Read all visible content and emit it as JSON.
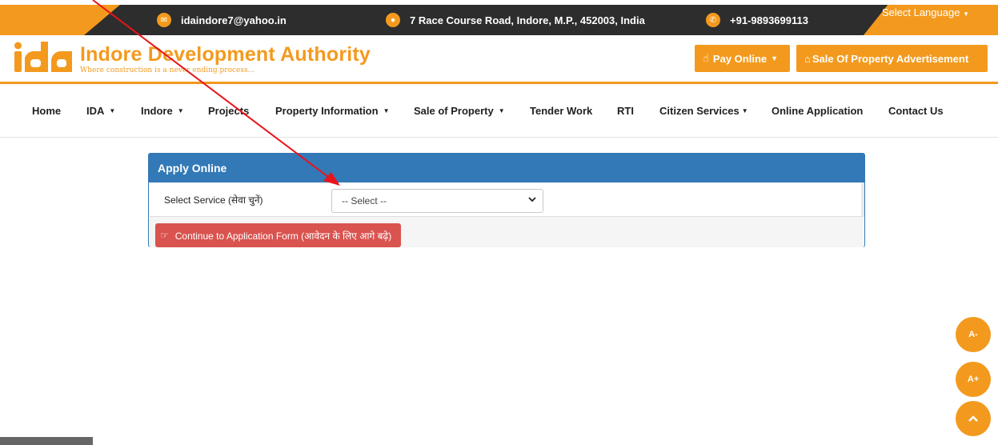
{
  "topbar": {
    "email": "idaindore7@yahoo.in",
    "address": "7 Race Course Road, Indore, M.P., 452003, India",
    "phone": "+91-9893699113",
    "language": "Select Language"
  },
  "header": {
    "logo_text": "ida",
    "title": "Indore Development Authority",
    "tagline": "Where construction is a never ending process...",
    "pay_online": "Pay Online",
    "sale_ad": "Sale Of Property Advertisement"
  },
  "nav": {
    "items": [
      {
        "label": "Home"
      },
      {
        "label": "IDA"
      },
      {
        "label": "Indore"
      },
      {
        "label": "Projects"
      },
      {
        "label": "Property Information"
      },
      {
        "label": "Sale of Property"
      },
      {
        "label": "Tender Work"
      },
      {
        "label": "RTI"
      },
      {
        "label": "Citizen Services"
      },
      {
        "label": "Online Application"
      },
      {
        "label": "Contact Us"
      }
    ]
  },
  "panel": {
    "heading": "Apply Online",
    "select_label": "Select Service  (सेवा चुनें)",
    "select_value": "-- Select --",
    "continue_label": "Continue to Application Form (आवेदन के लिए आगे बढ़े)"
  },
  "floating": {
    "decrease": "A-",
    "increase": "A+"
  },
  "colors": {
    "accent": "#f39a1e",
    "dark_bar": "#2d2d2d",
    "panel_blue": "#3379b7",
    "danger": "#d9534f",
    "annotation": "#e8141a"
  }
}
